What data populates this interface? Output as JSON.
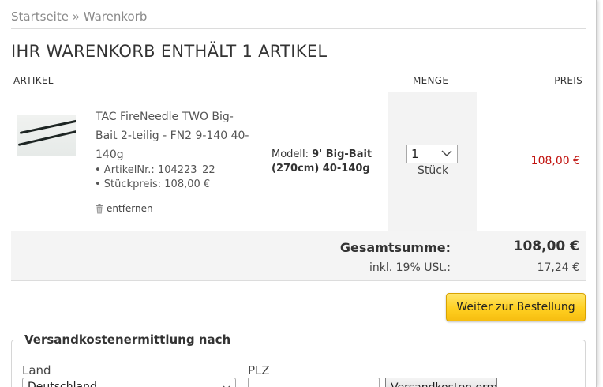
{
  "breadcrumb": {
    "home": "Startseite",
    "separator": "»",
    "current": "Warenkorb"
  },
  "page_title": "IHR WARENKORB ENTHÄLT 1 ARTIKEL",
  "table_headers": {
    "article": "ARTIKEL",
    "quantity": "MENGE",
    "price": "PREIS"
  },
  "cart_items": [
    {
      "name": "TAC FireNeedle TWO Big-Bait 2-teilig - FN2 9-140 40-140g",
      "article_no": "• ArtikelNr.: 104223_22",
      "unit_price": "• Stückpreis: 108,00 €",
      "remove_label": "entfernen",
      "model_label": "Modell:",
      "model_value": "9' Big-Bait (270cm) 40-140g",
      "quantity": "1",
      "quantity_unit": "Stück",
      "price": "108,00 €",
      "thumbnail_icon": "fishing-rod-thumbnail"
    }
  ],
  "totals": {
    "total_label": "Gesamtsumme:",
    "total_value": "108,00 €",
    "tax_label": "inkl. 19% USt.:",
    "tax_value": "17,24 €"
  },
  "checkout_button_label": "Weiter zur Bestellung",
  "shipping": {
    "legend": "Versandkostenermittlung nach",
    "country_label": "Land",
    "country_value": "Deutschland",
    "zip_label": "PLZ",
    "zip_value": "",
    "calc_button_label": "Versandkosten ermitteln"
  },
  "colors": {
    "price_red": "#c1120e",
    "button_yellow": "#ffd021",
    "text_dark": "#333333",
    "text_muted": "#8a8a8a"
  }
}
